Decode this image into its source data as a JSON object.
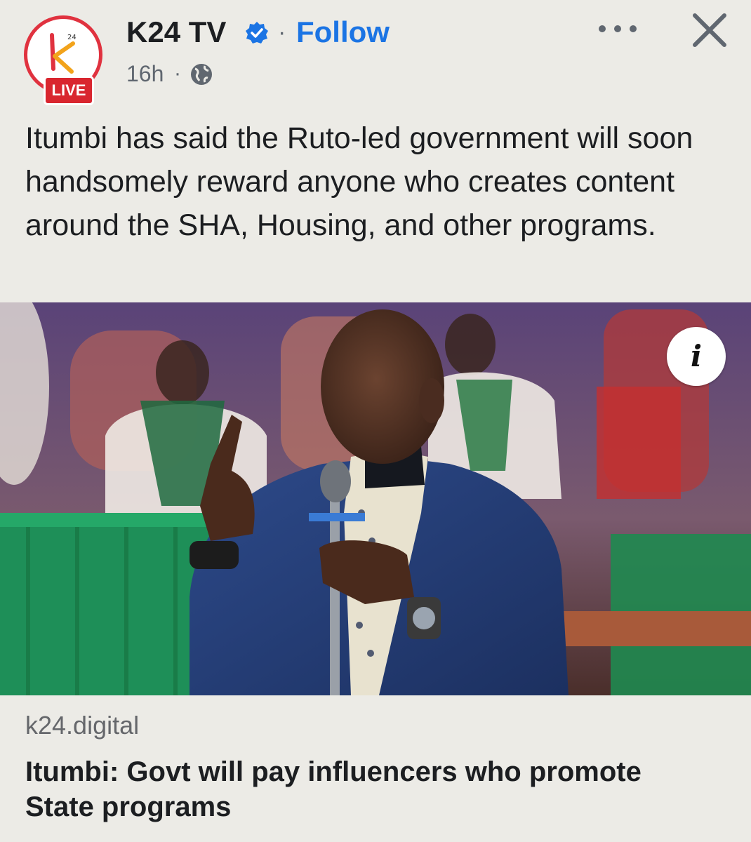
{
  "post": {
    "page_name": "K24 TV",
    "separator": "·",
    "follow_label": "Follow",
    "timestamp": "16h",
    "timestamp_separator": "·",
    "live_badge": "LIVE",
    "logo_text": "k24",
    "caption": "Itumbi has said the Ruto-led government will soon handsomely reward anyone who creates content around the SHA, Housing, and other programs.",
    "icons": {
      "verified": "verified-badge-icon",
      "audience": "globe-icon",
      "more": "more-options-icon",
      "close": "close-icon",
      "info": "info-icon"
    }
  },
  "link_preview": {
    "domain": "k24.digital",
    "title": "Itumbi: Govt will pay influencers who promote State programs",
    "info_label": "i"
  },
  "colors": {
    "background": "#ecebe6",
    "follow": "#1b74e4",
    "live_badge": "#d9262f",
    "verified": "#1b74e4"
  }
}
